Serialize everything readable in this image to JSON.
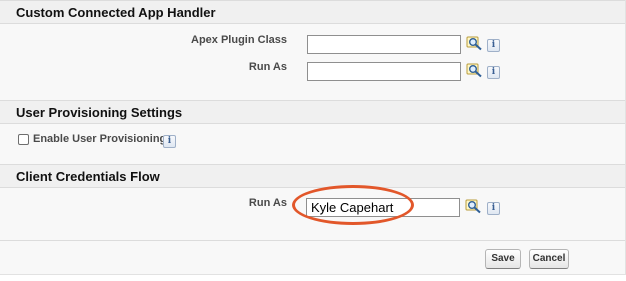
{
  "sections": {
    "custom_handler": {
      "title": "Custom Connected App Handler",
      "apex_plugin_class": {
        "label": "Apex Plugin Class",
        "value": ""
      },
      "run_as": {
        "label": "Run As",
        "value": ""
      }
    },
    "user_provisioning": {
      "title": "User Provisioning Settings",
      "enable_label": "Enable User Provisioning",
      "enabled": false
    },
    "client_credentials": {
      "title": "Client Credentials Flow",
      "run_as": {
        "label": "Run As",
        "value": "Kyle Capehart"
      }
    }
  },
  "info_glyph": "i",
  "buttons": {
    "save": "Save",
    "cancel": "Cancel"
  },
  "icons": {
    "lookup": "lookup-magnifier-icon",
    "info": "info-icon"
  },
  "colors": {
    "highlight": "#e2572a",
    "section_header_bg": "#f0f0f0",
    "body_bg": "#f8f8f8"
  }
}
